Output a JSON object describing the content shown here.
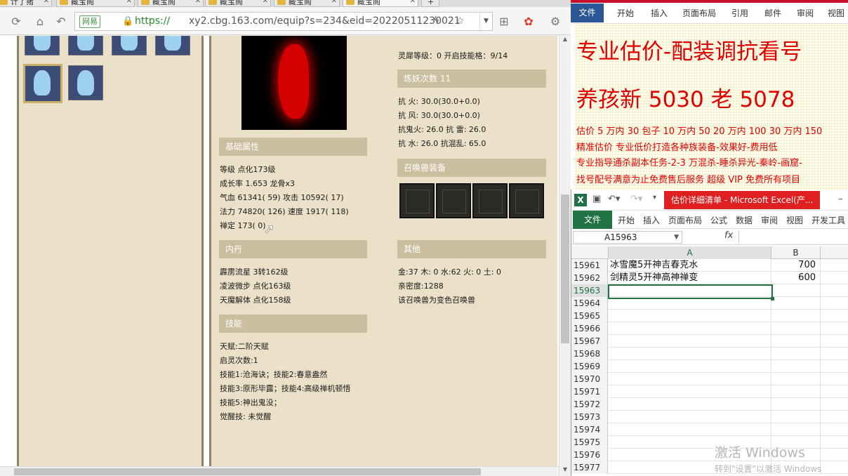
{
  "browser": {
    "tabs": [
      {
        "label": "计了猪"
      },
      {
        "label": "藏宝阁"
      },
      {
        "label": "藏宝阁"
      },
      {
        "label": "藏宝阁"
      },
      {
        "label": "藏宝阁"
      },
      {
        "label": "藏宝阁"
      }
    ],
    "security_label": "网易",
    "url_scheme": "https://",
    "url_rest": "xy2.cbg.163.com/equip?s=234&eid=20220511230021",
    "icons": [
      "refresh-icon",
      "home-icon",
      "back-icon",
      "lock-icon",
      "bolt-icon",
      "star-icon",
      "dropdown-icon",
      "grid-icon",
      "game-icon",
      "tools-icon"
    ]
  },
  "detail": {
    "top_line": "灵犀等级：0    开启技能格：9/14",
    "sections": {
      "basic": "基础属性",
      "neidan": "内丹",
      "skills": "技能",
      "lianyao": "炼妖次数 11",
      "equip": "召唤兽装备",
      "other": "其他"
    },
    "basic_lines": [
      "等级 点化173级",
      "成长率 1.653 龙骨x3",
      "气血 61341( 59) 攻击 10592( 17)",
      "法力 74820( 126) 速度 1917( 118)",
      "禅定 173( 0)"
    ],
    "neidan_lines": [
      "霹雳流星 3转162级",
      "凌波微步 点化163级",
      "天魔解体 点化158级"
    ],
    "skill_lines": [
      "天赋:二阶天赋",
      "启灵次数:1",
      "技能1:沧海诀；技能2:春意盎然",
      "技能3:原形毕露；技能4:高级禅机顿悟",
      "技能5:神出鬼没；",
      "觉醒技:  未觉醒"
    ],
    "resist_lines": [
      "抗  火: 30.0(30.0+0.0)",
      "抗  风: 30.0(30.0+0.0)",
      "抗鬼火: 26.0 抗  雷: 26.0",
      "抗  水: 26.0 抗混乱: 65.0"
    ],
    "other_lines": [
      "金:37 木: 0 水:62 火: 0 土: 0",
      "亲密度:1288",
      "该召唤兽为变色召唤兽"
    ]
  },
  "word": {
    "tabs": [
      "文件",
      "开始",
      "插入",
      "页面布局",
      "引用",
      "邮件",
      "审阅",
      "视图"
    ],
    "heading": "专业估价-配装调抗看号",
    "subheading": "养孩新 5030 老 5078",
    "lines": [
      "估价 5 万内 30 包子  10 万内 50  20 万内 100  30 万内 150",
      "精准估价  专业低价打造各种族装备-效果好-费用低",
      "专业指导通杀副本任务-2-3 万混杀-睡杀异光-秦岭-画窟-",
      "找号配号满意为止免费售后服务  超级 VIP 免费所有项目"
    ],
    "accent_color": "#e00000"
  },
  "excel": {
    "title": "估价详细清单 - Microsoft Excel(产...",
    "tabs": [
      "文件",
      "开始",
      "插入",
      "页面布局",
      "公式",
      "数据",
      "审阅",
      "视图",
      "开发工具"
    ],
    "name_box": "A15963",
    "fx": "fx",
    "columns": [
      "A",
      "B"
    ],
    "rows": [
      {
        "num": "15961",
        "a": "冰雪魔5开神吉春克水",
        "b": "700"
      },
      {
        "num": "15962",
        "a": "剑精灵5开神高神禅变",
        "b": "600"
      },
      {
        "num": "15963",
        "a": "",
        "b": ""
      },
      {
        "num": "15964",
        "a": "",
        "b": ""
      },
      {
        "num": "15965",
        "a": "",
        "b": ""
      },
      {
        "num": "15966",
        "a": "",
        "b": ""
      },
      {
        "num": "15967",
        "a": "",
        "b": ""
      },
      {
        "num": "15968",
        "a": "",
        "b": ""
      },
      {
        "num": "15969",
        "a": "",
        "b": ""
      },
      {
        "num": "15970",
        "a": "",
        "b": ""
      },
      {
        "num": "15971",
        "a": "",
        "b": ""
      },
      {
        "num": "15972",
        "a": "",
        "b": ""
      },
      {
        "num": "15973",
        "a": "",
        "b": ""
      },
      {
        "num": "15974",
        "a": "",
        "b": ""
      },
      {
        "num": "15975",
        "a": "",
        "b": ""
      },
      {
        "num": "15976",
        "a": "",
        "b": ""
      },
      {
        "num": "15977",
        "a": "",
        "b": ""
      }
    ],
    "active_row": "15963"
  },
  "watermark": {
    "line1": "激活 Windows",
    "line2": "转到\"设置\"以激活 Windows"
  }
}
